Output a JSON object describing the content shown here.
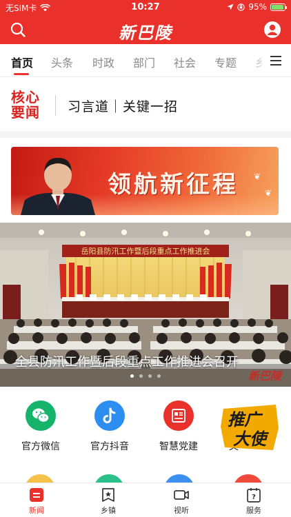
{
  "status_bar": {
    "carrier": "无SIM卡",
    "time": "10:27",
    "battery": "95%",
    "battery_level": 0.95
  },
  "header": {
    "logo_text": "新巴陵",
    "search_icon": "search-icon",
    "user_icon": "user-icon"
  },
  "nav": {
    "tabs": [
      "首页",
      "头条",
      "时政",
      "部门",
      "社会",
      "专题",
      "乡"
    ],
    "active_index": 0,
    "menu_icon": "menu-icon"
  },
  "headline": {
    "logo_line1": "核心",
    "logo_line2": "要闻",
    "text": "习言道｜关键一招"
  },
  "banner": {
    "text": "领航新征程"
  },
  "carousel": {
    "stage_sign": "岳阳县防汛工作暨后段重点工作推进会",
    "caption": "全县防汛工作暨后段重点工作推进会召开",
    "slide_count": 4,
    "active_slide": 0
  },
  "shortcuts": [
    {
      "label": "官方微信",
      "color": "#16b46a",
      "icon": "wechat-icon"
    },
    {
      "label": "官方抖音",
      "color": "#2c8ef0",
      "icon": "tiktok-icon"
    },
    {
      "label": "智慧党建",
      "color": "#e9302a",
      "icon": "party-building-icon"
    },
    {
      "label": "文",
      "color": "#f2a900",
      "icon": "promo-ambassador-icon"
    }
  ],
  "promo": {
    "line1": "推广",
    "line2": "大使"
  },
  "bottom_nav": [
    {
      "label": "新闻",
      "icon": "news-icon"
    },
    {
      "label": "乡镇",
      "icon": "township-icon"
    },
    {
      "label": "视听",
      "icon": "video-icon"
    },
    {
      "label": "服务",
      "icon": "service-icon"
    }
  ],
  "colors": {
    "brand_red": "#e9302a",
    "text_dark": "#222222",
    "text_muted": "#888888"
  }
}
